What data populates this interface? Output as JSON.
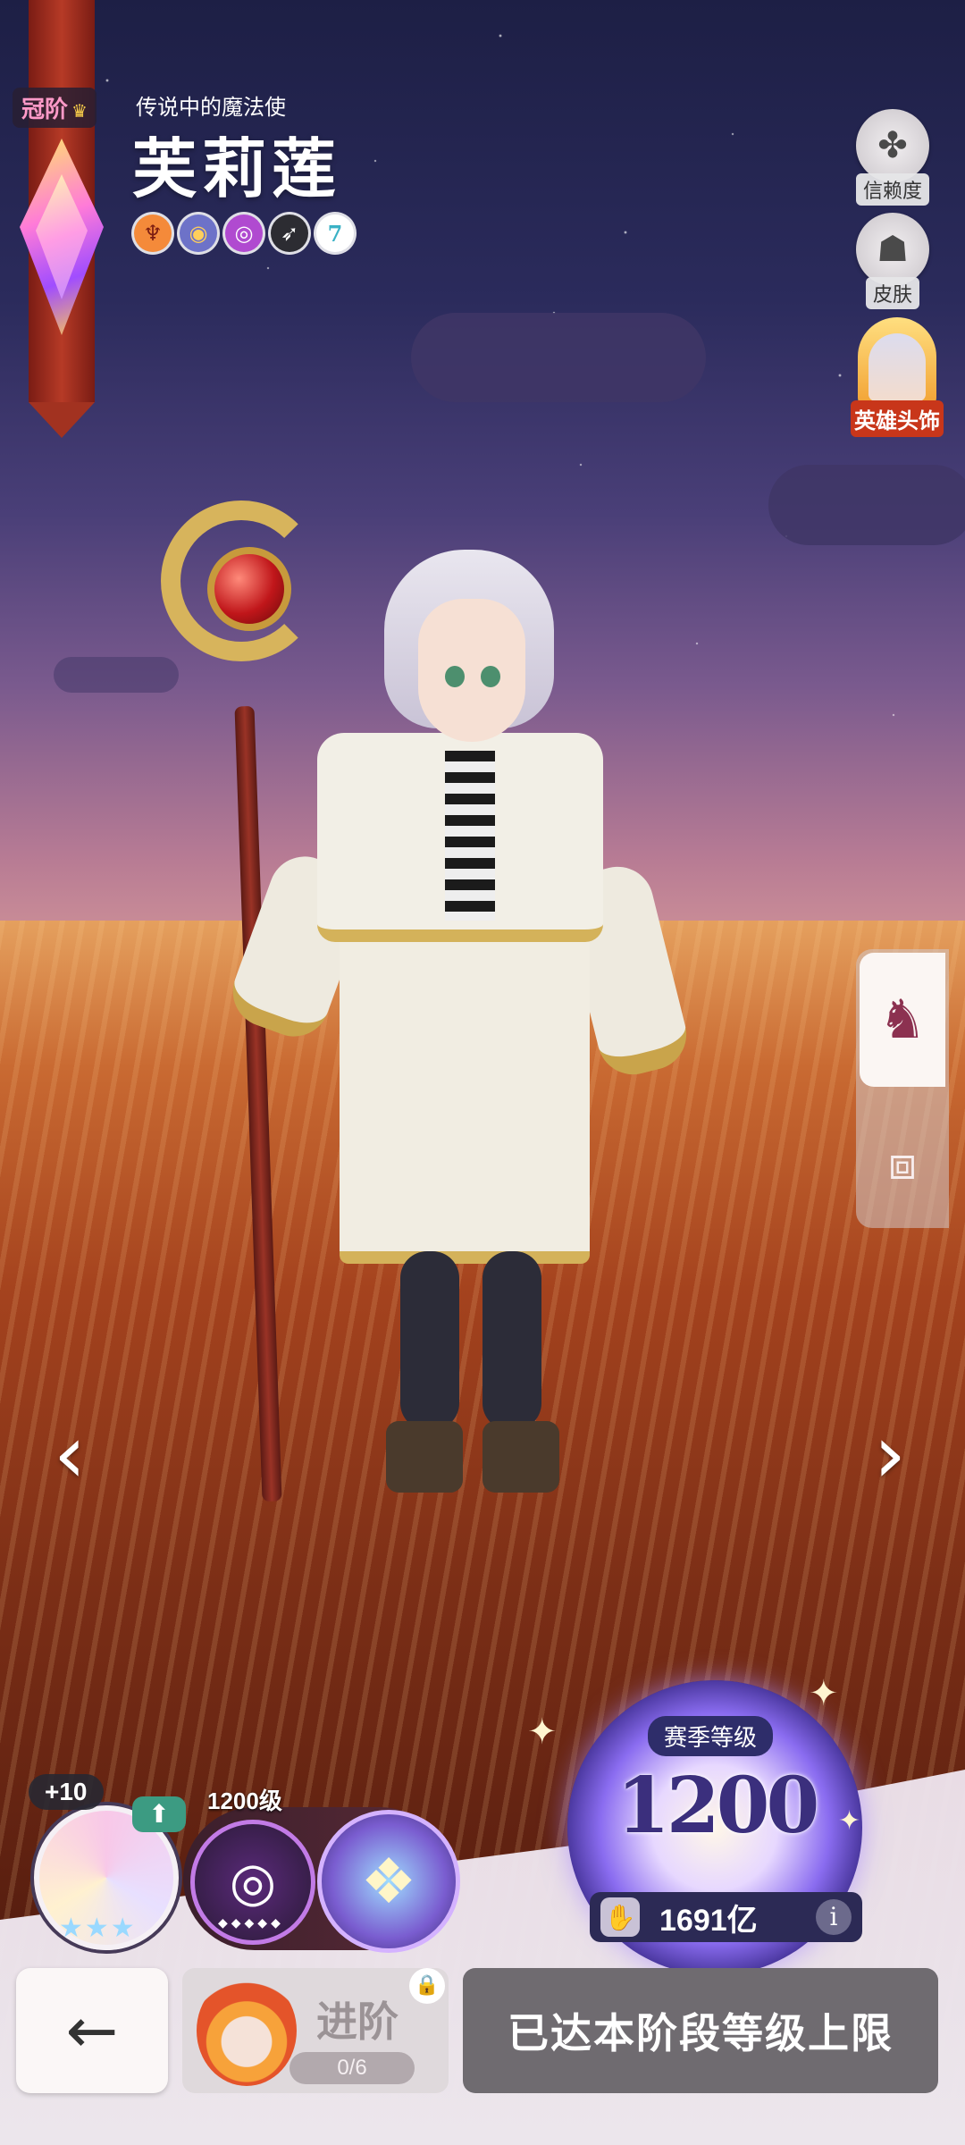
{
  "rank": {
    "label": "冠阶"
  },
  "hero": {
    "subtitle": "传说中的魔法使",
    "name": "芙莉莲",
    "traits": [
      {
        "icon": "trident-icon"
      },
      {
        "icon": "orb-icon"
      },
      {
        "icon": "magic-spiral-icon"
      },
      {
        "icon": "feather-icon"
      },
      {
        "icon": "number-badge",
        "value": "7"
      }
    ]
  },
  "right_menu": {
    "trust": {
      "label": "信赖度",
      "icon": "clover-icon"
    },
    "skin": {
      "label": "皮肤",
      "icon": "outfit-icon"
    },
    "headwear": {
      "label": "英雄头饰"
    }
  },
  "side_tabs": [
    {
      "icon": "helmet-icon",
      "active": true
    },
    {
      "icon": "card-icon",
      "active": false
    }
  ],
  "progress": {
    "plus_level": "+10",
    "star_count": 3,
    "level_label": "1200级"
  },
  "season": {
    "label": "赛季等级",
    "level": "1200",
    "currency_amount": "1691亿"
  },
  "buttons": {
    "back": "back-arrow-icon",
    "advance_label": "进阶",
    "advance_progress": "0/6",
    "maxed_label": "已达本阶段等级上限"
  },
  "colors": {
    "ribbon": "#b63a26",
    "headwear_label": "#c8361a",
    "maxed_button": "#6f6b70",
    "season_pill": "#2e2d6a"
  }
}
